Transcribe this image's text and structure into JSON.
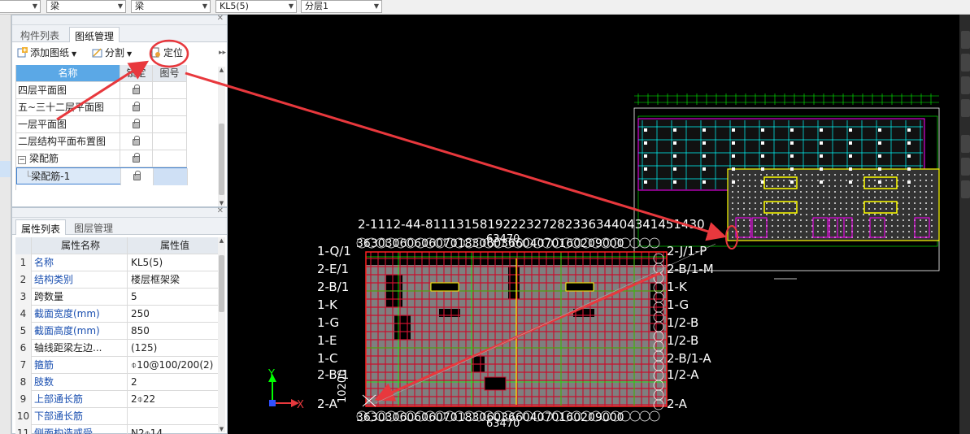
{
  "toolbar": {
    "dropdowns": [
      {
        "value": ""
      },
      {
        "value": "梁"
      },
      {
        "value": "梁"
      },
      {
        "value": "KL5(5)"
      },
      {
        "value": "分层1"
      }
    ]
  },
  "drawing_panel": {
    "tabs": [
      "构件列表",
      "图纸管理"
    ],
    "active_tab": "图纸管理",
    "tools": {
      "add": "添加图纸",
      "split": "分割",
      "locate": "定位"
    },
    "columns": {
      "name": "名称",
      "lock": "锁定",
      "number": "图号"
    },
    "rows": [
      {
        "name": "四层平面图"
      },
      {
        "name": "五~三十二层平面图"
      },
      {
        "name": "一层平面图"
      },
      {
        "name": "二层结构平面布置图"
      },
      {
        "name": "梁配筋",
        "group": true,
        "toggle": "−"
      },
      {
        "name": "梁配筋-1",
        "child": true,
        "selected": true
      }
    ]
  },
  "property_panel": {
    "tabs": [
      "属性列表",
      "图层管理"
    ],
    "active_tab": "属性列表",
    "columns": {
      "name": "属性名称",
      "value": "属性值"
    },
    "rows": [
      {
        "n": "1",
        "name": "名称",
        "value": "KL5(5)",
        "blue": true
      },
      {
        "n": "2",
        "name": "结构类别",
        "value": "楼层框架梁",
        "blue": true
      },
      {
        "n": "3",
        "name": "跨数量",
        "value": "5",
        "blue": false
      },
      {
        "n": "4",
        "name": "截面宽度(mm)",
        "value": "250",
        "blue": true
      },
      {
        "n": "5",
        "name": "截面高度(mm)",
        "value": "850",
        "blue": true
      },
      {
        "n": "6",
        "name": "轴线距梁左边...",
        "value": "(125)",
        "blue": false
      },
      {
        "n": "7",
        "name": "箍筋",
        "value": "⌽10@100/200(2)",
        "blue": true
      },
      {
        "n": "8",
        "name": "肢数",
        "value": "2",
        "blue": true
      },
      {
        "n": "9",
        "name": "上部通长筋",
        "value": "2⌽22",
        "blue": true
      },
      {
        "n": "10",
        "name": "下部通长筋",
        "value": "",
        "blue": true
      },
      {
        "n": "11",
        "name": "侧面构造或受...",
        "value": "N2⌽14",
        "blue": true
      }
    ]
  },
  "canvas": {
    "top_dimension": "63470",
    "bottom_dimension": "63470",
    "axis_x": "X",
    "axis_y": "Y",
    "left_axis_labels": [
      "1-Q/1",
      "2-E/1",
      "2-B/1",
      "1-K",
      "1-G",
      "1-E",
      "1-C",
      "2-B/1",
      "2-A"
    ],
    "right_axis_labels": [
      "2-J/1-P",
      "2-B/1-M",
      "1-K",
      "1-G",
      "1/2-B",
      "1/2-B",
      "2-B/1-A",
      "1/2-A",
      "2-A"
    ],
    "top_axis_text": "2-1112-44-811131581922232728233634404341451430",
    "top_dim_text": "3630306060607018306036604070160209000",
    "bottom_dim_text": "3630306060607018306036604070160209000",
    "left_vertical_text": "10200",
    "colors": {
      "annotation": "#e8383d",
      "grid_red": "#c8102e",
      "cad_white": "#ffffff",
      "cad_cyan": "#00ffff",
      "cad_green": "#00ff00",
      "cad_yellow": "#ffff00"
    }
  }
}
